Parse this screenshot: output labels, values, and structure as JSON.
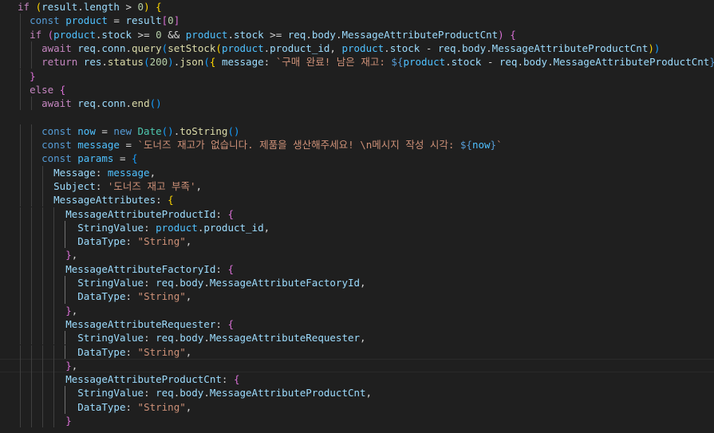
{
  "editor": {
    "language": "javascript",
    "theme": "dark",
    "lines": [
      [
        {
          "t": "if ",
          "c": "k1"
        },
        {
          "t": "(",
          "c": "b1"
        },
        {
          "t": "result",
          "c": "v"
        },
        {
          "t": ".",
          "c": "o"
        },
        {
          "t": "length",
          "c": "p"
        },
        {
          "t": " > ",
          "c": "o"
        },
        {
          "t": "0",
          "c": "n"
        },
        {
          "t": ")",
          "c": "b1"
        },
        {
          "t": " ",
          "c": "o"
        },
        {
          "t": "{",
          "c": "b1"
        }
      ],
      [
        {
          "t": "  ",
          "c": "o"
        },
        {
          "t": "const ",
          "c": "k2"
        },
        {
          "t": "product",
          "c": "c"
        },
        {
          "t": " = ",
          "c": "o"
        },
        {
          "t": "result",
          "c": "v"
        },
        {
          "t": "[",
          "c": "b2"
        },
        {
          "t": "0",
          "c": "n"
        },
        {
          "t": "]",
          "c": "b2"
        }
      ],
      [
        {
          "t": "  ",
          "c": "o"
        },
        {
          "t": "if ",
          "c": "k1"
        },
        {
          "t": "(",
          "c": "b2"
        },
        {
          "t": "product",
          "c": "c"
        },
        {
          "t": ".",
          "c": "o"
        },
        {
          "t": "stock",
          "c": "p"
        },
        {
          "t": " >= ",
          "c": "o"
        },
        {
          "t": "0",
          "c": "n"
        },
        {
          "t": " && ",
          "c": "o"
        },
        {
          "t": "product",
          "c": "c"
        },
        {
          "t": ".",
          "c": "o"
        },
        {
          "t": "stock",
          "c": "p"
        },
        {
          "t": " >= ",
          "c": "o"
        },
        {
          "t": "req",
          "c": "v"
        },
        {
          "t": ".",
          "c": "o"
        },
        {
          "t": "body",
          "c": "p"
        },
        {
          "t": ".",
          "c": "o"
        },
        {
          "t": "MessageAttributeProductCnt",
          "c": "p"
        },
        {
          "t": ")",
          "c": "b2"
        },
        {
          "t": " ",
          "c": "o"
        },
        {
          "t": "{",
          "c": "b2"
        }
      ],
      [
        {
          "t": "    ",
          "c": "o"
        },
        {
          "t": "await ",
          "c": "k1"
        },
        {
          "t": "req",
          "c": "v"
        },
        {
          "t": ".",
          "c": "o"
        },
        {
          "t": "conn",
          "c": "p"
        },
        {
          "t": ".",
          "c": "o"
        },
        {
          "t": "query",
          "c": "f"
        },
        {
          "t": "(",
          "c": "b3"
        },
        {
          "t": "setStock",
          "c": "f"
        },
        {
          "t": "(",
          "c": "b1"
        },
        {
          "t": "product",
          "c": "c"
        },
        {
          "t": ".",
          "c": "o"
        },
        {
          "t": "product_id",
          "c": "p"
        },
        {
          "t": ", ",
          "c": "o"
        },
        {
          "t": "product",
          "c": "c"
        },
        {
          "t": ".",
          "c": "o"
        },
        {
          "t": "stock",
          "c": "p"
        },
        {
          "t": " - ",
          "c": "o"
        },
        {
          "t": "req",
          "c": "v"
        },
        {
          "t": ".",
          "c": "o"
        },
        {
          "t": "body",
          "c": "p"
        },
        {
          "t": ".",
          "c": "o"
        },
        {
          "t": "MessageAttributeProductCnt",
          "c": "p"
        },
        {
          "t": ")",
          "c": "b1"
        },
        {
          "t": ")",
          "c": "b3"
        }
      ],
      [
        {
          "t": "    ",
          "c": "o"
        },
        {
          "t": "return ",
          "c": "k1"
        },
        {
          "t": "res",
          "c": "v"
        },
        {
          "t": ".",
          "c": "o"
        },
        {
          "t": "status",
          "c": "f"
        },
        {
          "t": "(",
          "c": "b3"
        },
        {
          "t": "200",
          "c": "n"
        },
        {
          "t": ")",
          "c": "b3"
        },
        {
          "t": ".",
          "c": "o"
        },
        {
          "t": "json",
          "c": "f"
        },
        {
          "t": "(",
          "c": "b3"
        },
        {
          "t": "{",
          "c": "b1"
        },
        {
          "t": " ",
          "c": "o"
        },
        {
          "t": "message",
          "c": "v"
        },
        {
          "t": ": ",
          "c": "o"
        },
        {
          "t": "`구매 완료! 남은 재고: ",
          "c": "s"
        },
        {
          "t": "${",
          "c": "k2"
        },
        {
          "t": "product",
          "c": "c"
        },
        {
          "t": ".",
          "c": "o"
        },
        {
          "t": "stock",
          "c": "p"
        },
        {
          "t": " - ",
          "c": "o"
        },
        {
          "t": "req",
          "c": "v"
        },
        {
          "t": ".",
          "c": "o"
        },
        {
          "t": "body",
          "c": "p"
        },
        {
          "t": ".",
          "c": "o"
        },
        {
          "t": "MessageAttributeProductCnt",
          "c": "p"
        },
        {
          "t": "}",
          "c": "k2"
        },
        {
          "t": "`",
          "c": "s"
        },
        {
          "t": "}",
          "c": "b1"
        },
        {
          "t": ")",
          "c": "b3"
        },
        {
          "t": ";",
          "c": "o"
        }
      ],
      [
        {
          "t": "  ",
          "c": "o"
        },
        {
          "t": "}",
          "c": "b2"
        }
      ],
      [
        {
          "t": "  ",
          "c": "o"
        },
        {
          "t": "else ",
          "c": "k1"
        },
        {
          "t": "{",
          "c": "b2"
        }
      ],
      [
        {
          "t": "    ",
          "c": "o"
        },
        {
          "t": "await ",
          "c": "k1"
        },
        {
          "t": "req",
          "c": "v"
        },
        {
          "t": ".",
          "c": "o"
        },
        {
          "t": "conn",
          "c": "p"
        },
        {
          "t": ".",
          "c": "o"
        },
        {
          "t": "end",
          "c": "f"
        },
        {
          "t": "()",
          "c": "b3"
        }
      ],
      [],
      [
        {
          "t": "    ",
          "c": "o"
        },
        {
          "t": "const ",
          "c": "k2"
        },
        {
          "t": "now",
          "c": "c"
        },
        {
          "t": " = ",
          "c": "o"
        },
        {
          "t": "new ",
          "c": "k2"
        },
        {
          "t": "Date",
          "c": "t"
        },
        {
          "t": "()",
          "c": "b3"
        },
        {
          "t": ".",
          "c": "o"
        },
        {
          "t": "toString",
          "c": "f"
        },
        {
          "t": "()",
          "c": "b3"
        }
      ],
      [
        {
          "t": "    ",
          "c": "o"
        },
        {
          "t": "const ",
          "c": "k2"
        },
        {
          "t": "message",
          "c": "c"
        },
        {
          "t": " = ",
          "c": "o"
        },
        {
          "t": "`도너즈 재고가 없습니다. 제품을 생산해주세요! \\n메시지 작성 시각: ",
          "c": "s"
        },
        {
          "t": "${",
          "c": "k2"
        },
        {
          "t": "now",
          "c": "c"
        },
        {
          "t": "}",
          "c": "k2"
        },
        {
          "t": "`",
          "c": "s"
        }
      ],
      [
        {
          "t": "    ",
          "c": "o"
        },
        {
          "t": "const ",
          "c": "k2"
        },
        {
          "t": "params",
          "c": "c"
        },
        {
          "t": " = ",
          "c": "o"
        },
        {
          "t": "{",
          "c": "b3"
        }
      ],
      [
        {
          "t": "      ",
          "c": "o"
        },
        {
          "t": "Message",
          "c": "v"
        },
        {
          "t": ": ",
          "c": "o"
        },
        {
          "t": "message",
          "c": "c"
        },
        {
          "t": ",",
          "c": "o"
        }
      ],
      [
        {
          "t": "      ",
          "c": "o"
        },
        {
          "t": "Subject",
          "c": "v"
        },
        {
          "t": ": ",
          "c": "o"
        },
        {
          "t": "'도너즈 재고 부족'",
          "c": "s"
        },
        {
          "t": ",",
          "c": "o"
        }
      ],
      [
        {
          "t": "      ",
          "c": "o"
        },
        {
          "t": "MessageAttributes",
          "c": "v"
        },
        {
          "t": ": ",
          "c": "o"
        },
        {
          "t": "{",
          "c": "b1"
        }
      ],
      [
        {
          "t": "        ",
          "c": "o"
        },
        {
          "t": "MessageAttributeProductId",
          "c": "v"
        },
        {
          "t": ": ",
          "c": "o"
        },
        {
          "t": "{",
          "c": "b2"
        }
      ],
      [
        {
          "t": "          ",
          "c": "o"
        },
        {
          "t": "StringValue",
          "c": "v"
        },
        {
          "t": ": ",
          "c": "o"
        },
        {
          "t": "product",
          "c": "c"
        },
        {
          "t": ".",
          "c": "o"
        },
        {
          "t": "product_id",
          "c": "p"
        },
        {
          "t": ",",
          "c": "o"
        }
      ],
      [
        {
          "t": "          ",
          "c": "o"
        },
        {
          "t": "DataType",
          "c": "v"
        },
        {
          "t": ": ",
          "c": "o"
        },
        {
          "t": "\"String\"",
          "c": "s"
        },
        {
          "t": ",",
          "c": "o"
        }
      ],
      [
        {
          "t": "        ",
          "c": "o"
        },
        {
          "t": "}",
          "c": "b2"
        },
        {
          "t": ",",
          "c": "o"
        }
      ],
      [
        {
          "t": "        ",
          "c": "o"
        },
        {
          "t": "MessageAttributeFactoryId",
          "c": "v"
        },
        {
          "t": ": ",
          "c": "o"
        },
        {
          "t": "{",
          "c": "b2"
        }
      ],
      [
        {
          "t": "          ",
          "c": "o"
        },
        {
          "t": "StringValue",
          "c": "v"
        },
        {
          "t": ": ",
          "c": "o"
        },
        {
          "t": "req",
          "c": "v"
        },
        {
          "t": ".",
          "c": "o"
        },
        {
          "t": "body",
          "c": "p"
        },
        {
          "t": ".",
          "c": "o"
        },
        {
          "t": "MessageAttributeFactoryId",
          "c": "p"
        },
        {
          "t": ",",
          "c": "o"
        }
      ],
      [
        {
          "t": "          ",
          "c": "o"
        },
        {
          "t": "DataType",
          "c": "v"
        },
        {
          "t": ": ",
          "c": "o"
        },
        {
          "t": "\"String\"",
          "c": "s"
        },
        {
          "t": ",",
          "c": "o"
        }
      ],
      [
        {
          "t": "        ",
          "c": "o"
        },
        {
          "t": "}",
          "c": "b2"
        },
        {
          "t": ",",
          "c": "o"
        }
      ],
      [
        {
          "t": "        ",
          "c": "o"
        },
        {
          "t": "MessageAttributeRequester",
          "c": "v"
        },
        {
          "t": ": ",
          "c": "o"
        },
        {
          "t": "{",
          "c": "b2"
        }
      ],
      [
        {
          "t": "          ",
          "c": "o"
        },
        {
          "t": "StringValue",
          "c": "v"
        },
        {
          "t": ": ",
          "c": "o"
        },
        {
          "t": "req",
          "c": "v"
        },
        {
          "t": ".",
          "c": "o"
        },
        {
          "t": "body",
          "c": "p"
        },
        {
          "t": ".",
          "c": "o"
        },
        {
          "t": "MessageAttributeRequester",
          "c": "p"
        },
        {
          "t": ",",
          "c": "o"
        }
      ],
      [
        {
          "t": "          ",
          "c": "o"
        },
        {
          "t": "DataType",
          "c": "v"
        },
        {
          "t": ": ",
          "c": "o"
        },
        {
          "t": "\"String\"",
          "c": "s"
        },
        {
          "t": ",",
          "c": "o"
        }
      ],
      [
        {
          "t": "        ",
          "c": "o"
        },
        {
          "t": "}",
          "c": "b2"
        },
        {
          "t": ",",
          "c": "o"
        }
      ],
      [
        {
          "t": "        ",
          "c": "o"
        },
        {
          "t": "MessageAttributeProductCnt",
          "c": "v"
        },
        {
          "t": ": ",
          "c": "o"
        },
        {
          "t": "{",
          "c": "b2"
        }
      ],
      [
        {
          "t": "          ",
          "c": "o"
        },
        {
          "t": "StringValue",
          "c": "v"
        },
        {
          "t": ": ",
          "c": "o"
        },
        {
          "t": "req",
          "c": "v"
        },
        {
          "t": ".",
          "c": "o"
        },
        {
          "t": "body",
          "c": "p"
        },
        {
          "t": ".",
          "c": "o"
        },
        {
          "t": "MessageAttributeProductCnt",
          "c": "p"
        },
        {
          "t": ",",
          "c": "o"
        }
      ],
      [
        {
          "t": "          ",
          "c": "o"
        },
        {
          "t": "DataType",
          "c": "v"
        },
        {
          "t": ": ",
          "c": "o"
        },
        {
          "t": "\"String\"",
          "c": "s"
        },
        {
          "t": ",",
          "c": "o"
        }
      ],
      [
        {
          "t": "        ",
          "c": "o"
        },
        {
          "t": "}",
          "c": "b2"
        }
      ]
    ]
  }
}
